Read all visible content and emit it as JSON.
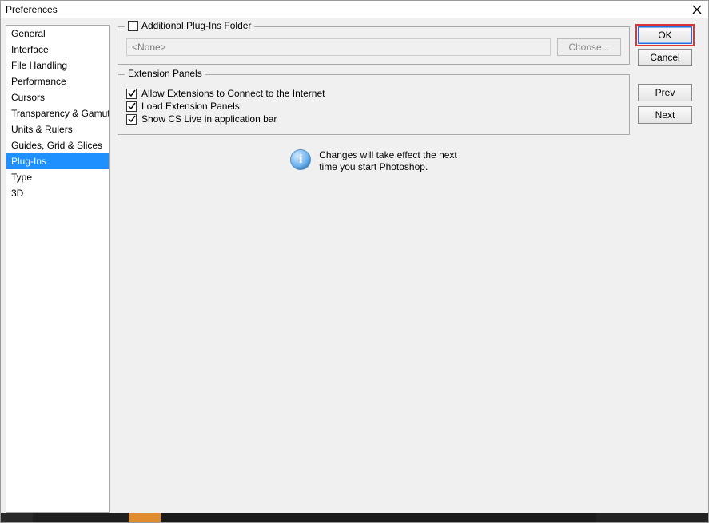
{
  "window": {
    "title": "Preferences"
  },
  "sidebar": {
    "items": [
      {
        "label": "General",
        "selected": false
      },
      {
        "label": "Interface",
        "selected": false
      },
      {
        "label": "File Handling",
        "selected": false
      },
      {
        "label": "Performance",
        "selected": false
      },
      {
        "label": "Cursors",
        "selected": false
      },
      {
        "label": "Transparency & Gamut",
        "selected": false
      },
      {
        "label": "Units & Rulers",
        "selected": false
      },
      {
        "label": "Guides, Grid & Slices",
        "selected": false
      },
      {
        "label": "Plug-Ins",
        "selected": true
      },
      {
        "label": "Type",
        "selected": false
      },
      {
        "label": "3D",
        "selected": false
      }
    ]
  },
  "plugins_folder": {
    "legend": "Additional Plug-Ins Folder",
    "checked": false,
    "path_display": "<None>",
    "choose_label": "Choose..."
  },
  "extension_panels": {
    "legend": "Extension Panels",
    "options": [
      {
        "label": "Allow Extensions to Connect to the Internet",
        "checked": true
      },
      {
        "label": "Load Extension Panels",
        "checked": true
      },
      {
        "label": "Show CS Live in application bar",
        "checked": true
      }
    ]
  },
  "info": {
    "line1": "Changes will take effect the next",
    "line2": "time you start Photoshop."
  },
  "buttons": {
    "ok": "OK",
    "cancel": "Cancel",
    "prev": "Prev",
    "next": "Next"
  }
}
